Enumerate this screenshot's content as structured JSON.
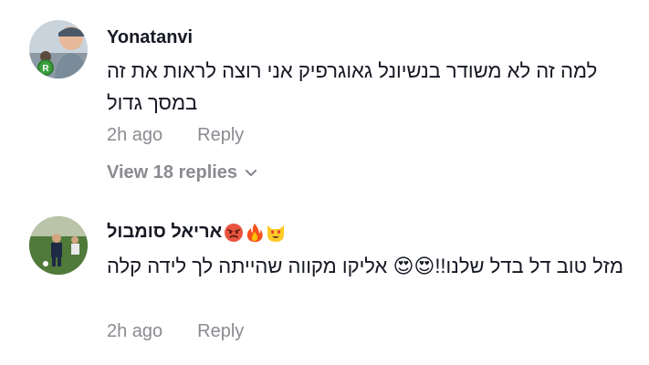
{
  "comments": [
    {
      "username": "Yonatanvi",
      "text": "למה זה לא משודר בנשיונל גאוגרפיק אני רוצה לראות את זה במסך גדול",
      "time": "2h ago",
      "reply_label": "Reply",
      "view_replies": "View 18 replies",
      "avatar_badge": "R"
    },
    {
      "username": "אריאל סומבול",
      "username_emojis": [
        "angry-face-emoji",
        "fire-emoji",
        "heart-eyes-cat-emoji"
      ],
      "text": "מזל טוב דל בדל שלנו!!😍😍 אליקו מקווה שהייתה לך לידה קלה",
      "time": "2h ago",
      "reply_label": "Reply"
    }
  ],
  "colors": {
    "text_primary": "#161823",
    "text_secondary": "#8a8b91",
    "badge_green": "#2e7d32"
  }
}
